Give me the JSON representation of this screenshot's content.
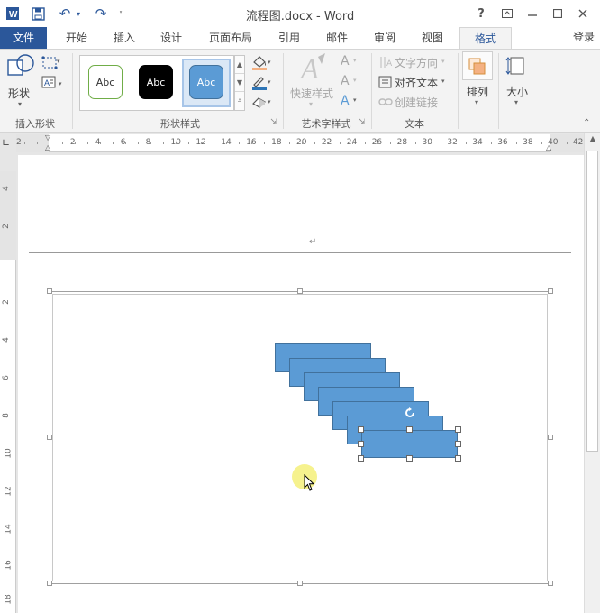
{
  "window": {
    "title": "流程图.docx - Word",
    "help_label": "?",
    "signin_label": "登录"
  },
  "tabs": [
    {
      "label": "文件"
    },
    {
      "label": "开始"
    },
    {
      "label": "插入"
    },
    {
      "label": "设计"
    },
    {
      "label": "页面布局"
    },
    {
      "label": "引用"
    },
    {
      "label": "邮件"
    },
    {
      "label": "审阅"
    },
    {
      "label": "视图"
    },
    {
      "label": "格式"
    }
  ],
  "ribbon": {
    "insert_shapes": {
      "shapes_label": "形状",
      "group_label": "插入形状"
    },
    "shape_styles": {
      "group_label": "形状样式",
      "swatches": [
        {
          "label": "Abc",
          "fill": "#ffffff",
          "border": "#70ad47",
          "text": "#333333"
        },
        {
          "label": "Abc",
          "fill": "#000000",
          "border": "#000000",
          "text": "#ffffff"
        },
        {
          "label": "Abc",
          "fill": "#5b9bd5",
          "border": "#41719c",
          "text": "#ffffff"
        }
      ]
    },
    "wordart": {
      "quick_styles_label": "快速样式",
      "group_label": "艺术字样式",
      "glyph": "A"
    },
    "text": {
      "direction_label": "文字方向",
      "align_label": "对齐文本",
      "link_label": "创建链接",
      "group_label": "文本"
    },
    "arrange": {
      "label": "排列"
    },
    "size": {
      "label": "大小"
    }
  },
  "ruler": {
    "h_labels": [
      "2",
      "2",
      "4",
      "6",
      "8",
      "10",
      "12",
      "14",
      "16",
      "18",
      "20",
      "22",
      "24",
      "26",
      "28",
      "30",
      "32",
      "34",
      "36",
      "38",
      "40",
      "42"
    ],
    "v_labels": [
      "4",
      "2",
      "2",
      "4",
      "6",
      "8",
      "10",
      "12",
      "14",
      "16",
      "18"
    ]
  },
  "document": {
    "paragraph_mark": "↵",
    "shape_color": "#5b9bd5",
    "shape_count": 7
  },
  "colors": {
    "accent": "#2b579a",
    "context_tab": "#c55a11",
    "cursor_highlight": "#f5f07a"
  }
}
